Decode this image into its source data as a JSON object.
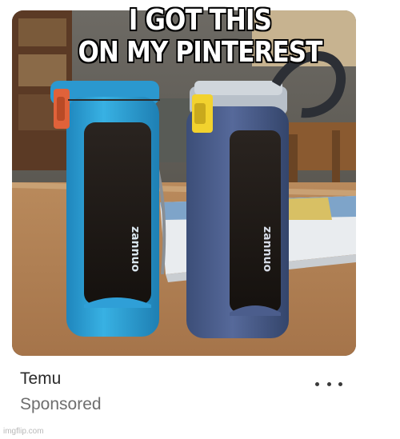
{
  "caption": {
    "line1": "I GOT THIS",
    "line2": "ON MY PINTEREST"
  },
  "pin": {
    "bottle_brand_text": "zannuo",
    "advertiser": "Temu",
    "sponsored_label": "Sponsored",
    "more_icon": "more-horizontal-icon"
  },
  "watermark": "imgflip.com",
  "colors": {
    "bottle_left": "#2fa3d6",
    "bottle_right": "#4a5d8c",
    "cap_left_clip": "#e0623a",
    "cap_right_clip": "#f2d22e"
  }
}
